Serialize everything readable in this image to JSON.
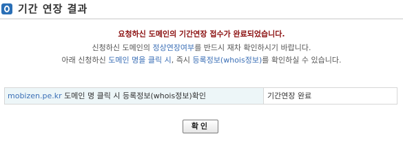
{
  "header": {
    "title": "기간 연장 결과",
    "icon": "circle-o-icon"
  },
  "message": {
    "heading": "요청하신 도메인의 기간연장 접수가 완료되었습니다.",
    "line1_a": "신청하신 도메인의 ",
    "line1_link": "정상연장여부",
    "line1_b": "를 반드시 재차 확인하시기 바랍니다.",
    "line2_a": "아래 신청하신 ",
    "line2_link1": "도메인 명을 클릭 시",
    "line2_b": ", 즉시 ",
    "line2_link2": "등록정보(whois정보)",
    "line2_c": "를 확인하실 수 있습니다."
  },
  "result": {
    "domain": "mobizen.pe.kr",
    "description": " 도메인 명 클릭 시 등록정보(whois정보)확인",
    "status": "기간연장 완료"
  },
  "actions": {
    "ok_label": "확인"
  },
  "colors": {
    "heading": "#8b0f0f",
    "link": "#3b6fb6",
    "icon_bg": "#2a6fb6",
    "cell_bg": "#edf6f8"
  }
}
